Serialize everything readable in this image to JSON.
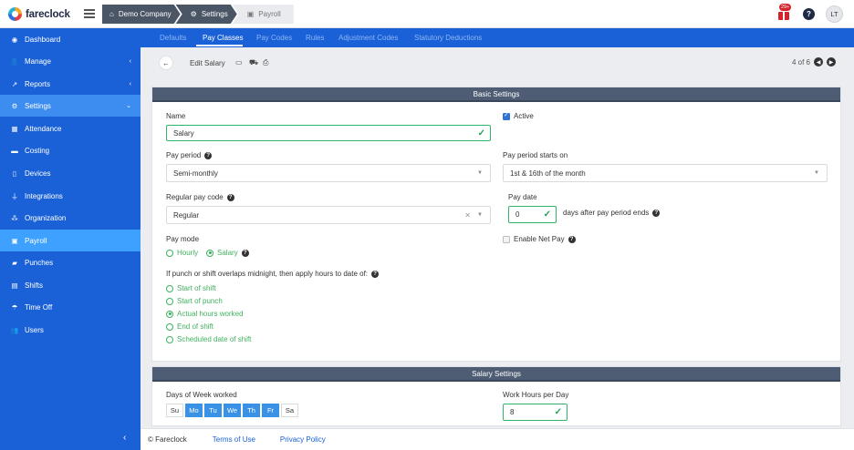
{
  "app": {
    "name": "fareclock"
  },
  "breadcrumb": [
    {
      "label": "Demo Company",
      "icon": "home-icon"
    },
    {
      "label": "Settings",
      "icon": "gear-icon"
    },
    {
      "label": "Payroll",
      "icon": "payroll-icon"
    }
  ],
  "header": {
    "notification_count": "29+",
    "user_initials": "LT"
  },
  "sidebar": {
    "items": [
      {
        "label": "Dashboard",
        "icon": "dashboard-icon"
      },
      {
        "label": "Manage",
        "icon": "person-icon"
      },
      {
        "label": "Reports",
        "icon": "chart-icon"
      },
      {
        "label": "Settings",
        "icon": "gear-icon"
      },
      {
        "label": "Attendance",
        "icon": "attendance-icon"
      },
      {
        "label": "Costing",
        "icon": "folder-icon"
      },
      {
        "label": "Devices",
        "icon": "tablet-icon"
      },
      {
        "label": "Integrations",
        "icon": "plug-icon"
      },
      {
        "label": "Organization",
        "icon": "org-icon"
      },
      {
        "label": "Payroll",
        "icon": "payroll-icon"
      },
      {
        "label": "Punches",
        "icon": "car-icon"
      },
      {
        "label": "Shifts",
        "icon": "clipboard-icon"
      },
      {
        "label": "Time Off",
        "icon": "beach-icon"
      },
      {
        "label": "Users",
        "icon": "users-icon"
      }
    ]
  },
  "tabs": [
    "Defaults",
    "Pay Classes",
    "Pay Codes",
    "Rules",
    "Adjustment Codes",
    "Statutory Deductions"
  ],
  "toolbar": {
    "title": "Edit Salary",
    "pager": "4 of 6"
  },
  "basic": {
    "heading": "Basic Settings",
    "name_label": "Name",
    "name_value": "Salary",
    "active_label": "Active",
    "pay_period_label": "Pay period",
    "pay_period_value": "Semi-monthly",
    "pay_period_starts_label": "Pay period starts on",
    "pay_period_starts_value": "1st & 16th of the month",
    "regular_pay_code_label": "Regular pay code",
    "regular_pay_code_value": "Regular",
    "pay_date_label": "Pay date",
    "pay_date_value": "0",
    "pay_date_suffix": "days after pay period ends",
    "pay_mode_label": "Pay mode",
    "pay_mode_options": [
      "Hourly",
      "Salary"
    ],
    "enable_net_pay_label": "Enable Net Pay",
    "overlap_label": "If punch or shift overlaps midnight, then apply hours to date of:",
    "overlap_options": [
      "Start of shift",
      "Start of punch",
      "Actual hours worked",
      "End of shift",
      "Scheduled date of shift"
    ]
  },
  "salary": {
    "heading": "Salary Settings",
    "days_label": "Days of Week worked",
    "days": [
      "Su",
      "Mo",
      "Tu",
      "We",
      "Th",
      "Fr",
      "Sa"
    ],
    "work_hours_label": "Work Hours per Day",
    "work_hours_value": "8"
  },
  "footer": {
    "copyright": "© Fareclock",
    "terms": "Terms of Use",
    "privacy": "Privacy Policy"
  }
}
